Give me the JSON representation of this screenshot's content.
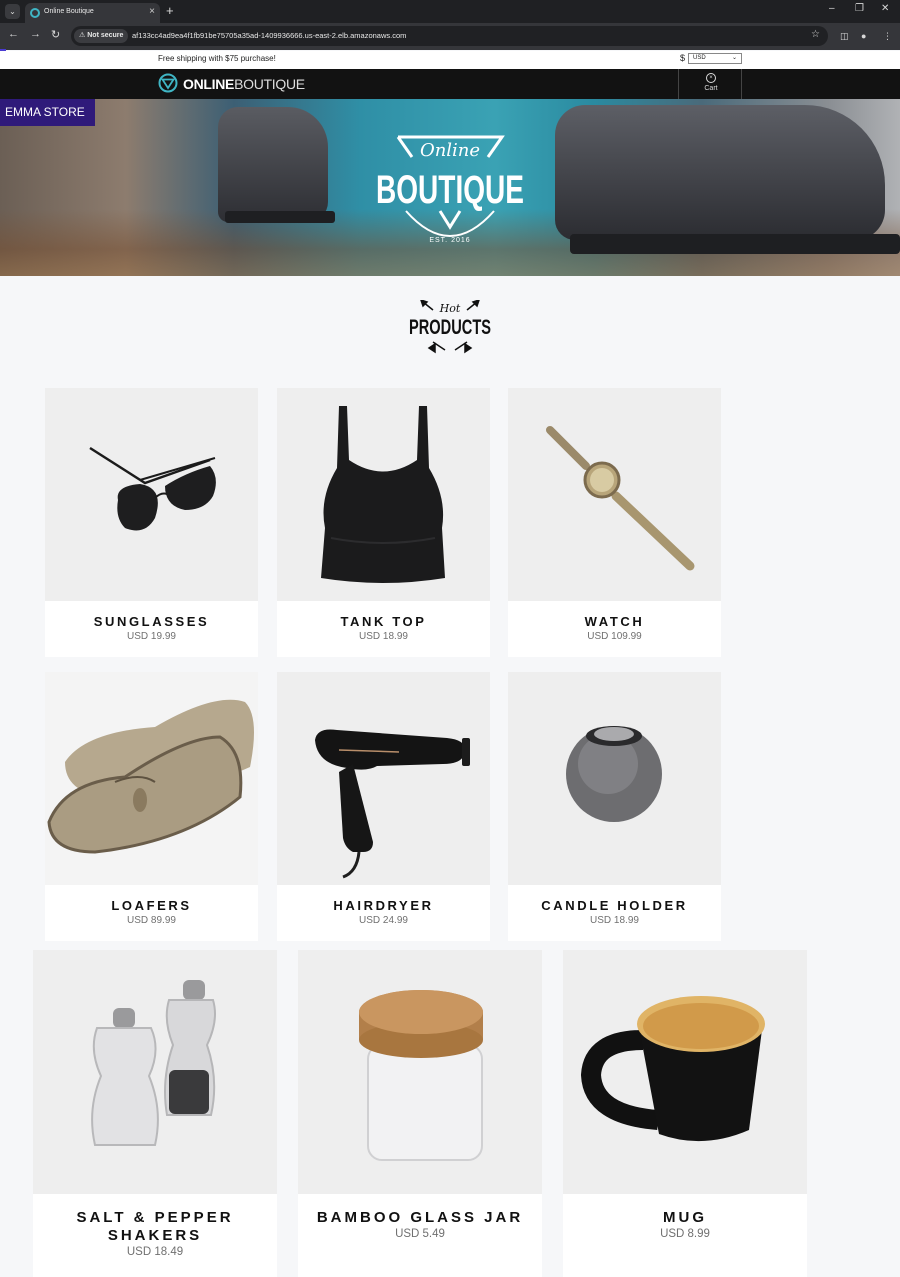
{
  "browser": {
    "tab_title": "Online Boutique",
    "security_label": "Not secure",
    "url": "af133cc4ad9ea4f1fb91be75705a35ad-1409936666.us-east-2.elb.amazonaws.com"
  },
  "topbar": {
    "promo": "Free shipping with $75 purchase!",
    "currency_symbol": "$",
    "currency_selected": "USD"
  },
  "nav": {
    "logo_bold": "ONLINE",
    "logo_light": "BOUTIQUE",
    "cart_label": "Cart"
  },
  "hero": {
    "store_badge": "EMMA STORE",
    "badge_script": "Online",
    "badge_title": "BOUTIQUE",
    "badge_est": "EST. 2016"
  },
  "section": {
    "heading_script": "Hot",
    "heading_title": "PRODUCTS"
  },
  "products": [
    {
      "name": "SUNGLASSES",
      "price": "USD 19.99"
    },
    {
      "name": "TANK TOP",
      "price": "USD 18.99"
    },
    {
      "name": "WATCH",
      "price": "USD 109.99"
    },
    {
      "name": "LOAFERS",
      "price": "USD 89.99"
    },
    {
      "name": "HAIRDRYER",
      "price": "USD 24.99"
    },
    {
      "name": "CANDLE HOLDER",
      "price": "USD 18.99"
    },
    {
      "name": "SALT & PEPPER SHAKERS",
      "price": "USD 18.49"
    },
    {
      "name": "BAMBOO GLASS JAR",
      "price": "USD 5.49"
    },
    {
      "name": "MUG",
      "price": "USD 8.99"
    }
  ],
  "icons": [
    "tab-search-icon",
    "close-icon",
    "new-tab-icon",
    "back-icon",
    "forward-icon",
    "reload-icon",
    "warning-icon",
    "star-icon",
    "sidepanel-icon",
    "profile-icon",
    "menu-icon",
    "cart-icon"
  ]
}
